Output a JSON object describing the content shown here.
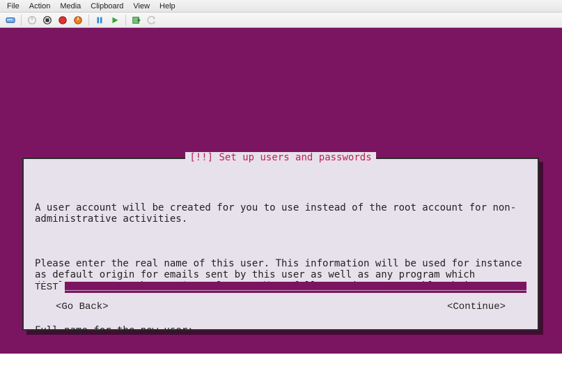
{
  "menubar": {
    "file": "File",
    "action": "Action",
    "media": "Media",
    "clipboard": "Clipboard",
    "view": "View",
    "help": "Help"
  },
  "toolbar_icons": {
    "ctrlaltdel": "ctrl-alt-del-icon",
    "turnoff": "turn-off-icon",
    "shutdown": "shutdown-icon",
    "save": "save-state-icon",
    "reset": "reset-icon",
    "pause": "pause-icon",
    "start": "start-icon",
    "checkpoint": "checkpoint-icon",
    "revert": "revert-icon"
  },
  "installer": {
    "title": "[!!] Set up users and passwords",
    "para1": "A user account will be created for you to use instead of the root account for non-administrative activities.",
    "para2": "Please enter the real name of this user. This information will be used for instance as default origin for emails sent by this user as well as any program which displays or uses the user's real name. Your full name is a reasonable choice.",
    "prompt": "Full name for the new user:",
    "input_value": "TEST",
    "go_back": "<Go Back>",
    "continue": "<Continue>"
  }
}
